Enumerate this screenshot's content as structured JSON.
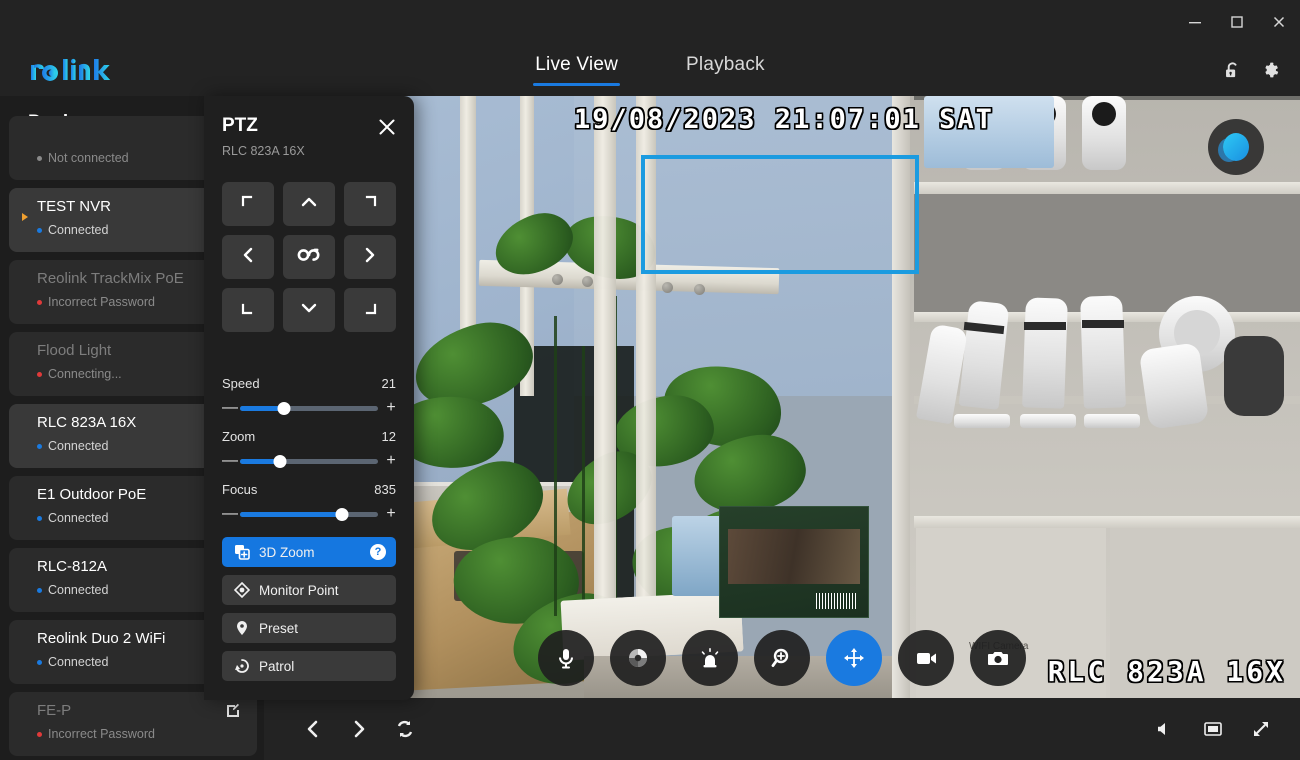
{
  "window": {
    "minimize_label": "Minimize",
    "maximize_label": "Maximize",
    "close_label": "Close"
  },
  "header": {
    "logo_text": "reolink",
    "tabs": [
      {
        "label": "Live View",
        "active": true
      },
      {
        "label": "Playback",
        "active": false
      }
    ],
    "right_icons": [
      "unlock-icon",
      "gear-icon"
    ]
  },
  "sidebar": {
    "title": "Device",
    "devices": [
      {
        "name": "",
        "status": "Not connected",
        "status_color": "#8a8a8a",
        "dim": true,
        "selected": false,
        "expander": false
      },
      {
        "name": "TEST NVR",
        "status": "Connected",
        "status_color": "#1a7ae0",
        "dim": false,
        "selected": true,
        "expander": true
      },
      {
        "name": "Reolink TrackMix PoE",
        "status": "Incorrect Password",
        "status_color": "#e03a3a",
        "dim": true,
        "selected": false,
        "expander": false
      },
      {
        "name": "Flood Light",
        "status": "Connecting...",
        "status_color": "#e03a3a",
        "dim": true,
        "selected": false,
        "expander": false
      },
      {
        "name": "RLC 823A 16X",
        "status": "Connected",
        "status_color": "#1a7ae0",
        "dim": false,
        "selected": true,
        "expander": false
      },
      {
        "name": "E1 Outdoor PoE",
        "status": "Connected",
        "status_color": "#1a7ae0",
        "dim": false,
        "selected": false,
        "expander": false
      },
      {
        "name": "RLC-812A",
        "status": "Connected",
        "status_color": "#1a7ae0",
        "dim": false,
        "selected": false,
        "expander": false
      },
      {
        "name": "Reolink Duo 2 WiFi",
        "status": "Connected",
        "status_color": "#1a7ae0",
        "dim": false,
        "selected": false,
        "expander": false
      },
      {
        "name": "FE-P",
        "status": "Incorrect Password",
        "status_color": "#e03a3a",
        "dim": true,
        "selected": false,
        "expander": false,
        "edit": true
      }
    ]
  },
  "video": {
    "timestamp": "19/08/2023 21:07:01 SAT",
    "camera_label": "RLC 823A 16X",
    "selection_color": "#1b9be0",
    "watermark": "nk",
    "shelf_text": "WIFI Camera",
    "toolbar": [
      {
        "name": "microphone-button",
        "icon": "microphone-icon",
        "active": false
      },
      {
        "name": "image-settings-button",
        "icon": "color-wheel-icon",
        "active": false
      },
      {
        "name": "siren-button",
        "icon": "siren-icon",
        "active": false
      },
      {
        "name": "digital-zoom-button",
        "icon": "magnifier-plus-icon",
        "active": false
      },
      {
        "name": "ptz-button",
        "icon": "move-arrows-icon",
        "active": true
      },
      {
        "name": "record-button",
        "icon": "video-camera-icon",
        "active": false
      },
      {
        "name": "snapshot-button",
        "icon": "camera-icon",
        "active": false
      }
    ]
  },
  "bottombar": {
    "left_icons": [
      "previous-icon",
      "next-icon",
      "refresh-icon"
    ],
    "right_icons": [
      "volume-icon",
      "layout-single-icon",
      "fullscreen-icon"
    ]
  },
  "ptz": {
    "title": "PTZ",
    "subtitle": "RLC 823A 16X",
    "close_label": "Close",
    "dpad": [
      {
        "name": "pan-up-left-button",
        "icon": "corner-top-left-icon"
      },
      {
        "name": "pan-up-button",
        "icon": "chevron-up-icon"
      },
      {
        "name": "pan-up-right-button",
        "icon": "corner-top-right-icon"
      },
      {
        "name": "pan-left-button",
        "icon": "chevron-left-icon"
      },
      {
        "name": "auto-scan-button",
        "icon": "infinity-icon"
      },
      {
        "name": "pan-right-button",
        "icon": "chevron-right-icon"
      },
      {
        "name": "pan-down-left-button",
        "icon": "corner-bottom-left-icon"
      },
      {
        "name": "pan-down-button",
        "icon": "chevron-down-icon"
      },
      {
        "name": "pan-down-right-button",
        "icon": "corner-bottom-right-icon"
      }
    ],
    "sliders": [
      {
        "label": "Speed",
        "value": "21",
        "percent": 32
      },
      {
        "label": "Zoom",
        "value": "12",
        "percent": 29
      },
      {
        "label": "Focus",
        "value": "835",
        "percent": 74
      }
    ],
    "actions": [
      {
        "label": "3D Zoom",
        "icon": "3d-zoom-icon",
        "primary": true,
        "help": "?"
      },
      {
        "label": "Monitor Point",
        "icon": "monitor-point-icon",
        "primary": false
      },
      {
        "label": "Preset",
        "icon": "pin-icon",
        "primary": false
      },
      {
        "label": "Patrol",
        "icon": "patrol-icon",
        "primary": false
      }
    ]
  }
}
